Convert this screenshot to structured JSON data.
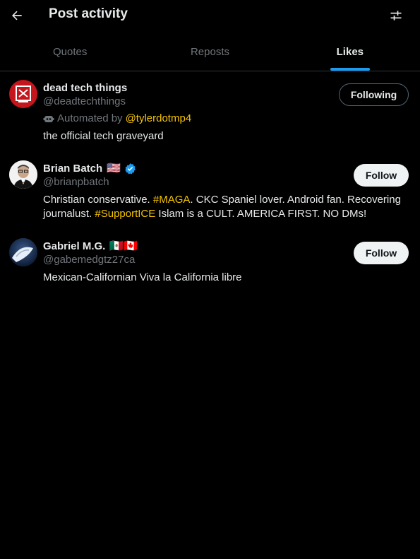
{
  "header": {
    "title": "Post activity",
    "back_icon": "arrow-left-icon",
    "filter_icon": "sliders-icon"
  },
  "tabs": [
    {
      "label": "Quotes",
      "active": false
    },
    {
      "label": "Reposts",
      "active": false
    },
    {
      "label": "Likes",
      "active": true
    }
  ],
  "users": [
    {
      "name": "dead tech things",
      "handle": "@deadtechthings",
      "automated_prefix": "Automated by",
      "automated_by": "@tylerdotmp4",
      "bio": "the official tech graveyard",
      "button": "Following"
    },
    {
      "name": "Brian Batch",
      "flags": "🇺🇸",
      "handle": "@brianpbatch",
      "bio_before": "Christian conservative. ",
      "bio_tag1": "#MAGA",
      "bio_middle": ". CKC Spaniel lover. Android fan. Recovering journalust. ",
      "bio_tag2": "#SupportICE",
      "bio_after": " Islam is a CULT. AMERICA FIRST. NO DMs!",
      "button": "Follow"
    },
    {
      "name": "Gabriel M.G.",
      "flags": "🇲🇽🇨🇦",
      "handle": "@gabemedgtz27ca",
      "bio": "Mexican-Californian Viva la California libre",
      "button": "Follow"
    }
  ],
  "colors": {
    "background": "#000000",
    "text": "#e7e9ea",
    "muted": "#71767b",
    "accent": "#1d9bf0",
    "link": "#f5c400"
  }
}
